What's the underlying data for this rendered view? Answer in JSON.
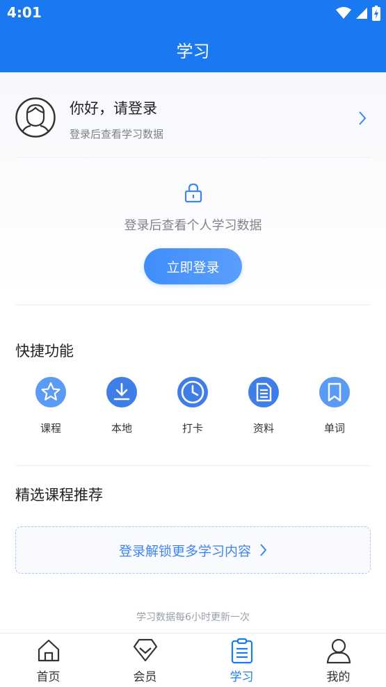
{
  "status_bar": {
    "time": "4:01"
  },
  "app_bar": {
    "title": "学习"
  },
  "user": {
    "greeting": "你好，请登录",
    "subtitle": "登录后查看学习数据"
  },
  "login_panel": {
    "message": "登录后查看个人学习数据",
    "button_label": "立即登录"
  },
  "quick_functions": {
    "title": "快捷功能",
    "items": [
      {
        "label": "课程",
        "icon": "star-icon"
      },
      {
        "label": "本地",
        "icon": "download-icon"
      },
      {
        "label": "打卡",
        "icon": "clock-icon"
      },
      {
        "label": "资料",
        "icon": "document-icon"
      },
      {
        "label": "单词",
        "icon": "bookmark-icon"
      }
    ]
  },
  "recommendations": {
    "title": "精选课程推荐",
    "unlock_label": "登录解锁更多学习内容"
  },
  "footnote": "学习数据每6小时更新一次",
  "tabs": [
    {
      "label": "首页",
      "icon": "home-icon",
      "active": false
    },
    {
      "label": "会员",
      "icon": "diamond-icon",
      "active": false
    },
    {
      "label": "学习",
      "icon": "clipboard-icon",
      "active": true
    },
    {
      "label": "我的",
      "icon": "person-icon",
      "active": false
    }
  ],
  "colors": {
    "primary": "#1a79f0",
    "accent": "#3f84f5",
    "text": "#222222",
    "muted": "#7b7f87"
  }
}
